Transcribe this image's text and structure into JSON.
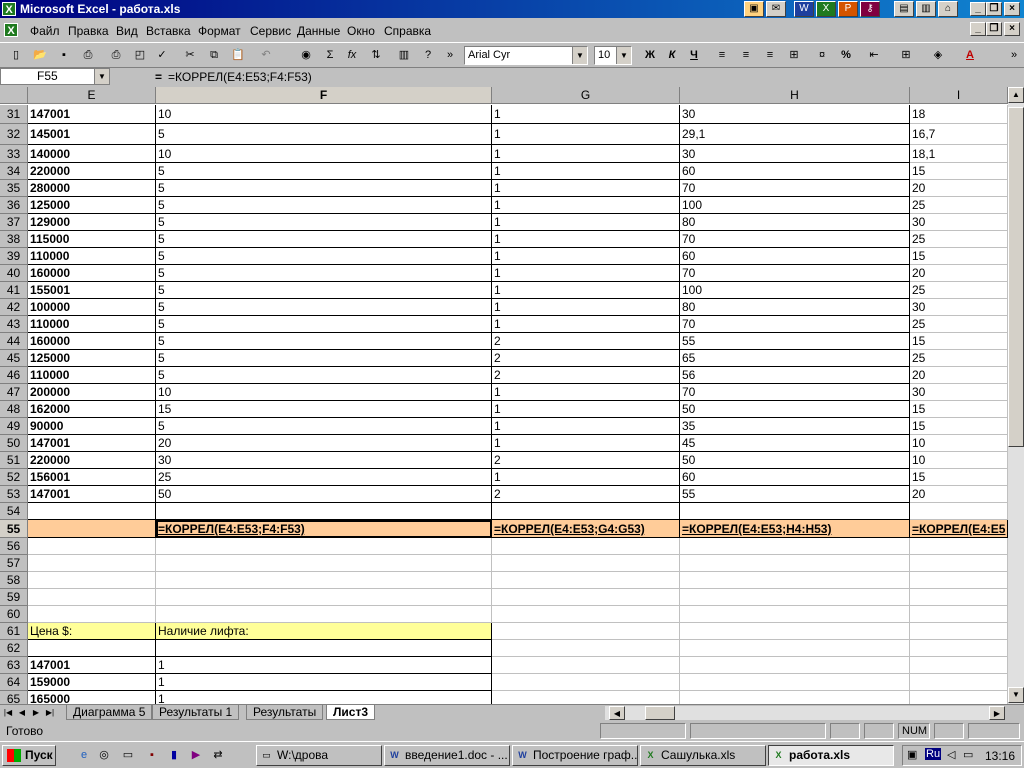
{
  "window": {
    "title": "Microsoft Excel - работа.xls",
    "icon": "excel-icon"
  },
  "menu": [
    "Файл",
    "Правка",
    "Вид",
    "Вставка",
    "Формат",
    "Сервис",
    "Данные",
    "Окно",
    "Справка"
  ],
  "toolbar": {
    "font_name": "Arial Cyr",
    "font_size": "10",
    "bold": "Ж",
    "italic": "К",
    "underline": "Ч",
    "sum": "Σ",
    "fx": "fx",
    "percent": "%"
  },
  "formula_bar": {
    "name_box": "F55",
    "equals": "=",
    "formula": "=КОРРЕЛ(E4:E53;F4:F53)"
  },
  "columns": [
    "E",
    "F",
    "G",
    "H",
    "I"
  ],
  "rows": [
    {
      "n": "31",
      "E": "147001",
      "F": "10",
      "G": "1",
      "H": "30",
      "I": "18"
    },
    {
      "n": "32",
      "E": "145001",
      "F": "5",
      "G": "1",
      "H": "29,1",
      "I": "16,7"
    },
    {
      "n": "33",
      "E": "140000",
      "F": "10",
      "G": "1",
      "H": "30",
      "I": "18,1"
    },
    {
      "n": "34",
      "E": "220000",
      "F": "5",
      "G": "1",
      "H": "60",
      "I": "15"
    },
    {
      "n": "35",
      "E": "280000",
      "F": "5",
      "G": "1",
      "H": "70",
      "I": "20"
    },
    {
      "n": "36",
      "E": "125000",
      "F": "5",
      "G": "1",
      "H": "100",
      "I": "25"
    },
    {
      "n": "37",
      "E": "129000",
      "F": "5",
      "G": "1",
      "H": "80",
      "I": "30"
    },
    {
      "n": "38",
      "E": "115000",
      "F": "5",
      "G": "1",
      "H": "70",
      "I": "25"
    },
    {
      "n": "39",
      "E": "110000",
      "F": "5",
      "G": "1",
      "H": "60",
      "I": "15"
    },
    {
      "n": "40",
      "E": "160000",
      "F": "5",
      "G": "1",
      "H": "70",
      "I": "20"
    },
    {
      "n": "41",
      "E": "155001",
      "F": "5",
      "G": "1",
      "H": "100",
      "I": "25"
    },
    {
      "n": "42",
      "E": "100000",
      "F": "5",
      "G": "1",
      "H": "80",
      "I": "30"
    },
    {
      "n": "43",
      "E": "110000",
      "F": "5",
      "G": "1",
      "H": "70",
      "I": "25"
    },
    {
      "n": "44",
      "E": "160000",
      "F": "5",
      "G": "2",
      "H": "55",
      "I": "15"
    },
    {
      "n": "45",
      "E": "125000",
      "F": "5",
      "G": "2",
      "H": "65",
      "I": "25"
    },
    {
      "n": "46",
      "E": "110000",
      "F": "5",
      "G": "2",
      "H": "56",
      "I": "20"
    },
    {
      "n": "47",
      "E": "200000",
      "F": "10",
      "G": "1",
      "H": "70",
      "I": "30"
    },
    {
      "n": "48",
      "E": "162000",
      "F": "15",
      "G": "1",
      "H": "50",
      "I": "15"
    },
    {
      "n": "49",
      "E": "90000",
      "F": "5",
      "G": "1",
      "H": "35",
      "I": "15"
    },
    {
      "n": "50",
      "E": "147001",
      "F": "20",
      "G": "1",
      "H": "45",
      "I": "10"
    },
    {
      "n": "51",
      "E": "220000",
      "F": "30",
      "G": "2",
      "H": "50",
      "I": "10"
    },
    {
      "n": "52",
      "E": "156001",
      "F": "25",
      "G": "1",
      "H": "60",
      "I": "15"
    },
    {
      "n": "53",
      "E": "147001",
      "F": "50",
      "G": "2",
      "H": "55",
      "I": "20"
    },
    {
      "n": "54",
      "E": "",
      "F": "",
      "G": "",
      "H": "",
      "I": ""
    },
    {
      "n": "55",
      "E": "",
      "F": "=КОРРЕЛ(E4:E53;F4:F53)",
      "G": "=КОРРЕЛ(E4:E53;G4:G53)",
      "H": "=КОРРЕЛ(E4:E53;H4:H53)",
      "I": "=КОРРЕЛ(E4:E5"
    },
    {
      "n": "56",
      "E": "",
      "F": "",
      "G": "",
      "H": "",
      "I": ""
    },
    {
      "n": "57",
      "E": "",
      "F": "",
      "G": "",
      "H": "",
      "I": ""
    },
    {
      "n": "58",
      "E": "",
      "F": "",
      "G": "",
      "H": "",
      "I": ""
    },
    {
      "n": "59",
      "E": "",
      "F": "",
      "G": "",
      "H": "",
      "I": ""
    },
    {
      "n": "60",
      "E": "",
      "F": "",
      "G": "",
      "H": "",
      "I": ""
    },
    {
      "n": "61",
      "E": "Цена $:",
      "F": "Наличие лифта:",
      "G": "",
      "H": "",
      "I": ""
    },
    {
      "n": "62",
      "E": "",
      "F": "",
      "G": "",
      "H": "",
      "I": ""
    },
    {
      "n": "63",
      "E": "147001",
      "F": "1",
      "G": "",
      "H": "",
      "I": ""
    },
    {
      "n": "64",
      "E": "159000",
      "F": "1",
      "G": "",
      "H": "",
      "I": ""
    },
    {
      "n": "65",
      "E": "165000",
      "F": "1",
      "G": "",
      "H": "",
      "I": ""
    }
  ],
  "sheet_tabs": [
    "Диаграмма 5",
    "Результаты 1",
    "Результаты",
    "Лист3"
  ],
  "active_sheet": "Лист3",
  "status": {
    "text": "Готово",
    "num": "NUM"
  },
  "taskbar": {
    "start": "Пуск",
    "tasks": [
      "W:\\дрова",
      "введение1.doc - ...",
      "Построение граф...",
      "Сашулька.xls",
      "работа.xls"
    ],
    "active_task": "работа.xls",
    "lang": "Ru",
    "clock": "13:16"
  }
}
